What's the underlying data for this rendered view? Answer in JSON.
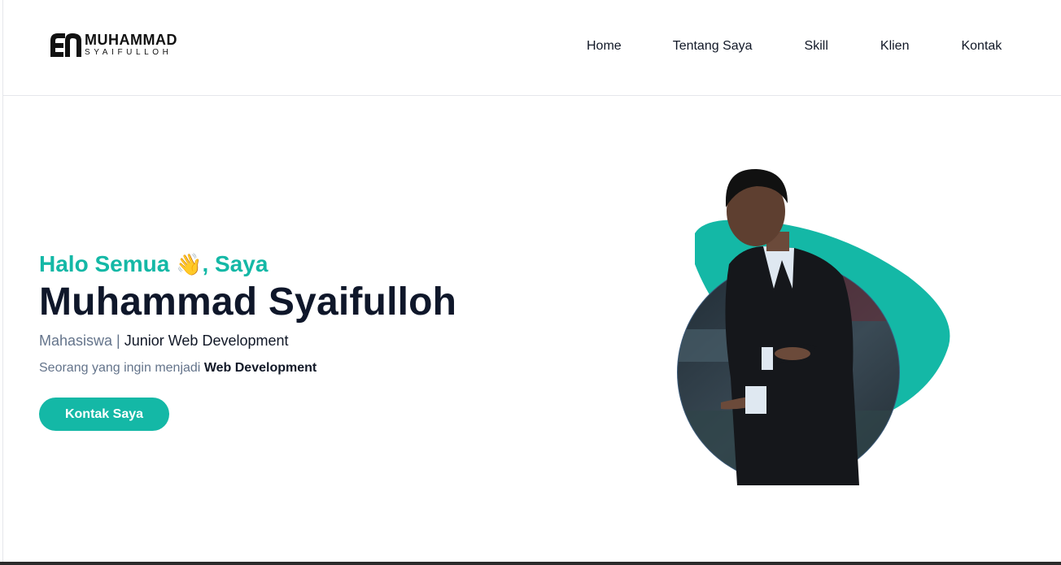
{
  "brand": {
    "name": "MUHAMMAD",
    "subname": "SYAIFULLOH",
    "mark_icon": "mf-monogram-logo"
  },
  "nav": {
    "items": [
      {
        "label": "Home"
      },
      {
        "label": "Tentang Saya"
      },
      {
        "label": "Skill"
      },
      {
        "label": "Klien"
      },
      {
        "label": "Kontak"
      }
    ]
  },
  "hero": {
    "greeting_pre": "Halo Semua",
    "greeting_emoji": "👋",
    "greeting_post": ", Saya",
    "name": "Muhammad Syaifulloh",
    "role_primary": "Mahasiswa",
    "role_separator": " | ",
    "role_secondary": "Junior Web Development",
    "desc_pre": "Seorang yang ingin menjadi ",
    "desc_bold": "Web Development",
    "cta_label": "Kontak Saya",
    "photo_icon": "profile-photo"
  },
  "colors": {
    "accent": "#14b8a6",
    "heading": "#0f172a",
    "muted": "#64748b"
  }
}
